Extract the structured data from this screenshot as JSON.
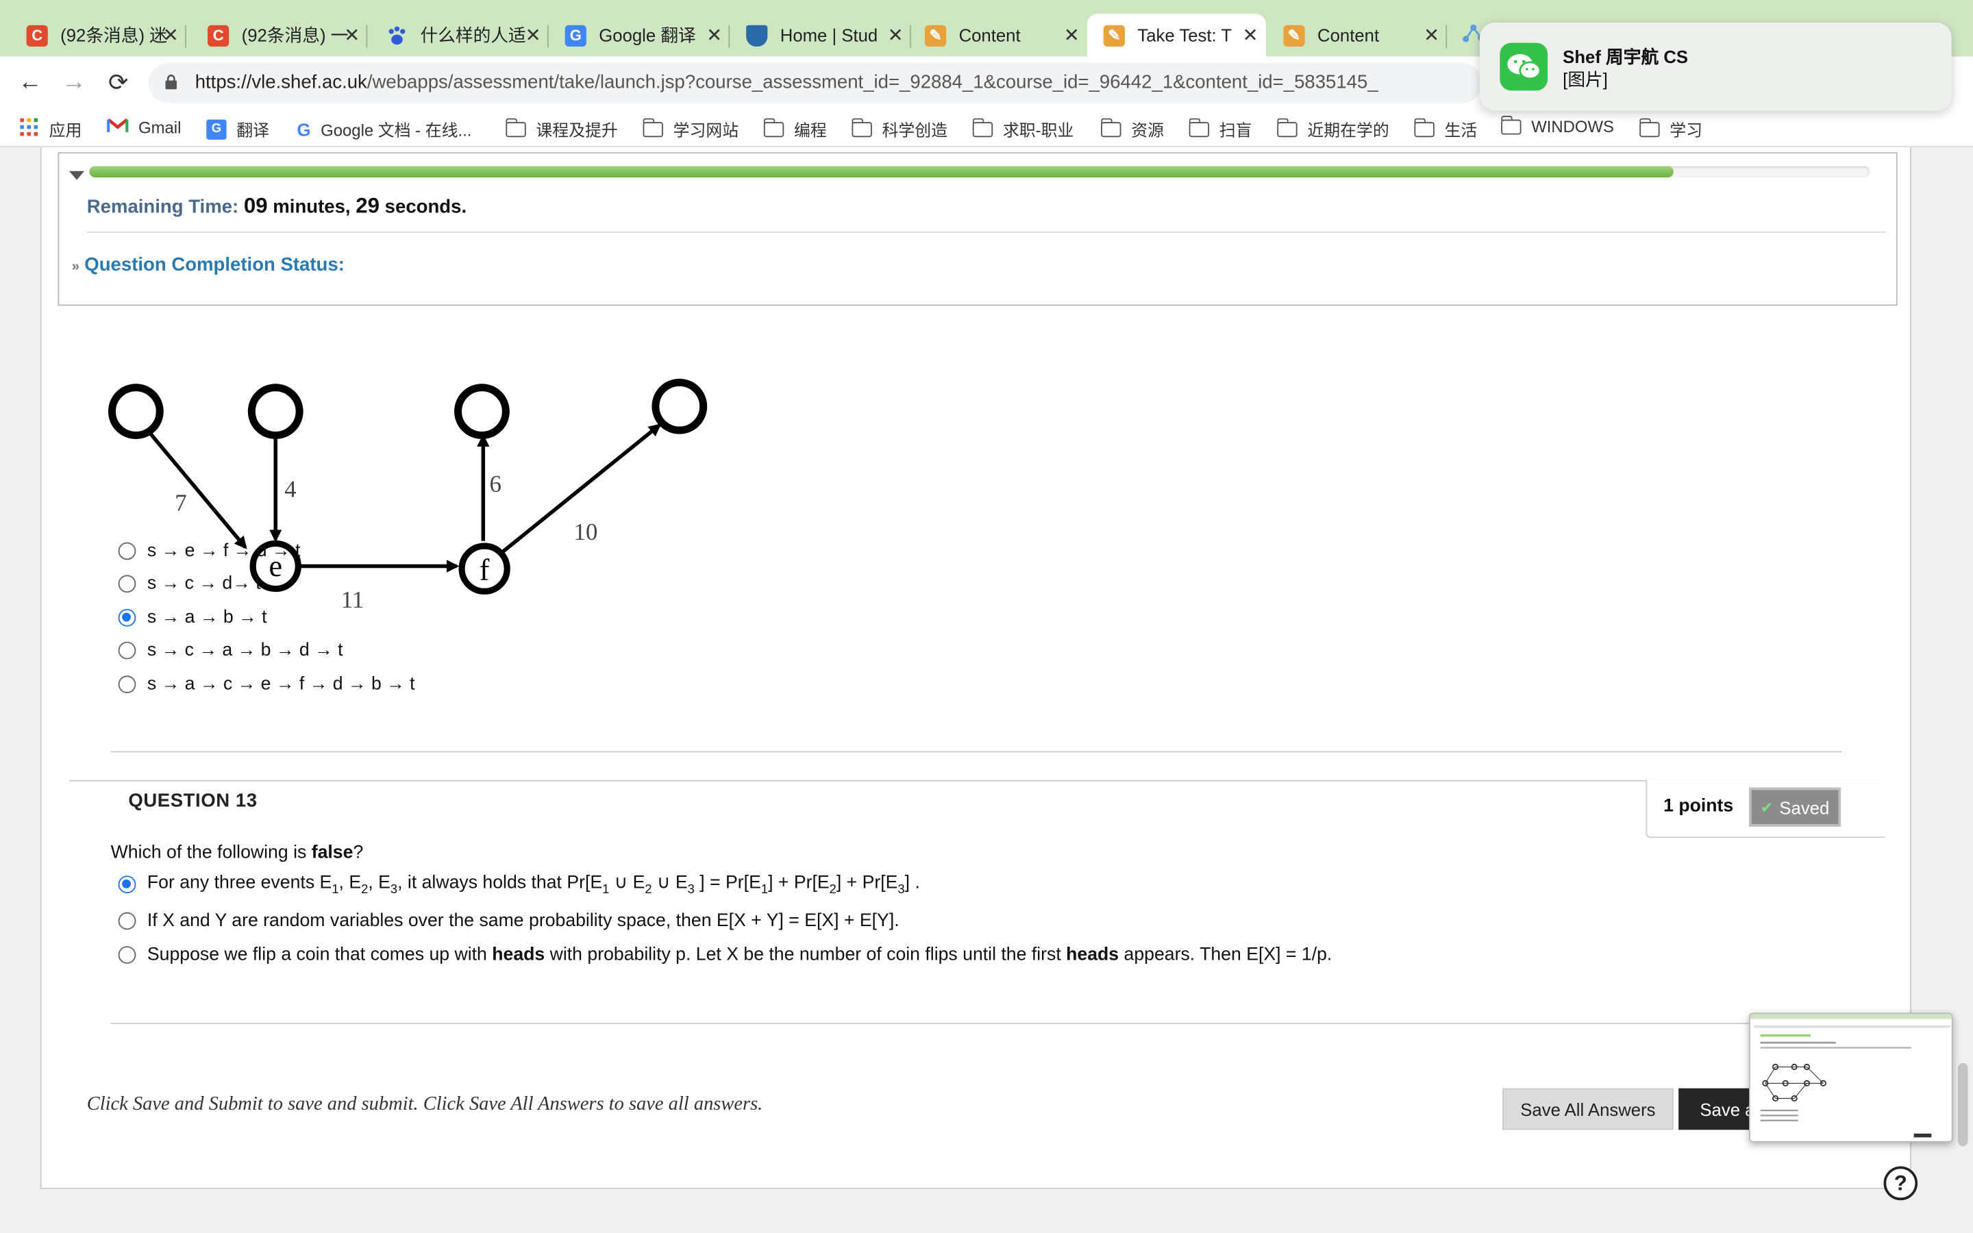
{
  "tabs": [
    {
      "title": "(92条消息) 迷",
      "favicon": "C",
      "color": "#e04a2f"
    },
    {
      "title": "(92条消息) 一",
      "favicon": "C",
      "color": "#e04a2f"
    },
    {
      "title": "什么样的人适",
      "favicon": "paw",
      "color": "#2e5bd6"
    },
    {
      "title": "Google 翻译",
      "favicon": "G",
      "color": "#4285f4"
    },
    {
      "title": "Home | Stud",
      "favicon": "crest",
      "color": "#2a6aa8"
    },
    {
      "title": "Content",
      "favicon": "pencil",
      "color": "#e8a23c"
    },
    {
      "title": "Take Test: T",
      "favicon": "pencil",
      "color": "#e8a23c"
    },
    {
      "title": "Content",
      "favicon": "pencil",
      "color": "#e8a23c"
    }
  ],
  "address": {
    "host": "https://vle.shef.ac.uk",
    "path": "/webapps/assessment/take/launch.jsp?course_assessment_id=_92884_1&course_id=_96442_1&content_id=_5835145_"
  },
  "bookmarks": [
    {
      "label": "应用",
      "icon": "apps-grid-icon"
    },
    {
      "label": "Gmail",
      "icon": "gmail-icon"
    },
    {
      "label": "翻译",
      "icon": "translate-icon"
    },
    {
      "label": "Google 文档 - 在线...",
      "icon": "google-icon"
    },
    {
      "label": "课程及提升",
      "icon": "folder-icon"
    },
    {
      "label": "学习网站",
      "icon": "folder-icon"
    },
    {
      "label": "编程",
      "icon": "folder-icon"
    },
    {
      "label": "科学创造",
      "icon": "folder-icon"
    },
    {
      "label": "求职-职业",
      "icon": "folder-icon"
    },
    {
      "label": "资源",
      "icon": "folder-icon"
    },
    {
      "label": "扫盲",
      "icon": "folder-icon"
    },
    {
      "label": "近期在学的",
      "icon": "folder-icon"
    },
    {
      "label": "生活",
      "icon": "folder-icon"
    },
    {
      "label": "WINDOWS",
      "icon": "folder-icon"
    },
    {
      "label": "学习",
      "icon": "folder-icon"
    }
  ],
  "notification": {
    "title": "Shef 周宇航 CS",
    "body": "[图片]"
  },
  "timer": {
    "progress_fraction": 0.89,
    "label": "Remaining Time:",
    "minutes": "09",
    "minutes_unit": "minutes,",
    "seconds": "29",
    "seconds_unit": "seconds.",
    "completion_status": "Question Completion Status:"
  },
  "graph": {
    "edge_weights": {
      "to_e_left": "7",
      "to_e_top": "4",
      "f_up": "6",
      "f_right": "10",
      "e_f": "11"
    },
    "node_labels": {
      "e": "e",
      "f": "f"
    }
  },
  "q12": {
    "options": [
      {
        "text": "s → e → f → d → t",
        "selected": false
      },
      {
        "text": "s → c → d→ t",
        "selected": false
      },
      {
        "text": "s → a → b → t",
        "selected": true
      },
      {
        "text": "s → c → a → b → d → t",
        "selected": false
      },
      {
        "text": "s → a → c → e → f → d → b → t",
        "selected": false
      }
    ]
  },
  "q13": {
    "title": "QUESTION 13",
    "points": "1 points",
    "saved": "Saved",
    "prompt_pre": "Which of the following is ",
    "prompt_bold": "false",
    "prompt_post": "?",
    "opt1": {
      "a": "For any three events E",
      "s1": "1",
      "b": ", E",
      "s2": "2",
      "c": ", E",
      "s3": "3",
      "d": ", it always holds that Pr[E",
      "s4": "1",
      "e": " ∪ E",
      "s5": "2",
      "f": " ∪ E",
      "s6": "3",
      "g": " ] =  Pr[E",
      "s7": "1",
      "h": "] + Pr[E",
      "s8": "2",
      "i": "] + Pr[E",
      "s9": "3",
      "j": "] .",
      "selected": true
    },
    "opt2": {
      "text": "If X and Y are random variables over the same probability space, then E[X + Y] = E[X] + E[Y].",
      "selected": false
    },
    "opt3": {
      "a": "Suppose we flip a coin that comes up with ",
      "b1": "heads",
      "c": " with probability p. Let X be the number of coin flips until the first ",
      "b2": "heads",
      "d": " appears. Then E[X] = 1/p.",
      "selected": false
    }
  },
  "footer": {
    "note": "Click Save and Submit to save and submit. Click Save All Answers to save all answers.",
    "save_all": "Save All Answers",
    "save_submit": "Save a"
  },
  "help_icon": "?"
}
